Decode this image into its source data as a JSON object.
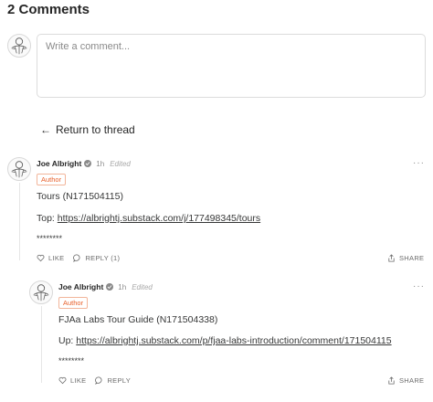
{
  "page": {
    "heading": "2 Comments",
    "composer_placeholder": "Write a comment...",
    "return_link_label": "Return to thread",
    "return_arrow": "←"
  },
  "comments": [
    {
      "author": "Joe Albright",
      "time": "1h",
      "edited": "Edited",
      "badge": "Author",
      "line1": "Tours (N171504115)",
      "line2_prefix": "Top: ",
      "line2_link": "https://albrightj.substack.com/j/177498345/tours",
      "line3": "********",
      "like_label": "LIKE",
      "reply_label": "REPLY (1)",
      "share_label": "SHARE",
      "more": "···"
    },
    {
      "author": "Joe Albright",
      "time": "1h",
      "edited": "Edited",
      "badge": "Author",
      "line1": "FJAa Labs Tour Guide (N171504338)",
      "line2_prefix": "Up: ",
      "line2_link": "https://albrightj.substack.com/p/fjaa-labs-introduction/comment/171504115",
      "line3": "********",
      "like_label": "LIKE",
      "reply_label": "REPLY",
      "share_label": "SHARE",
      "more": "···"
    }
  ]
}
